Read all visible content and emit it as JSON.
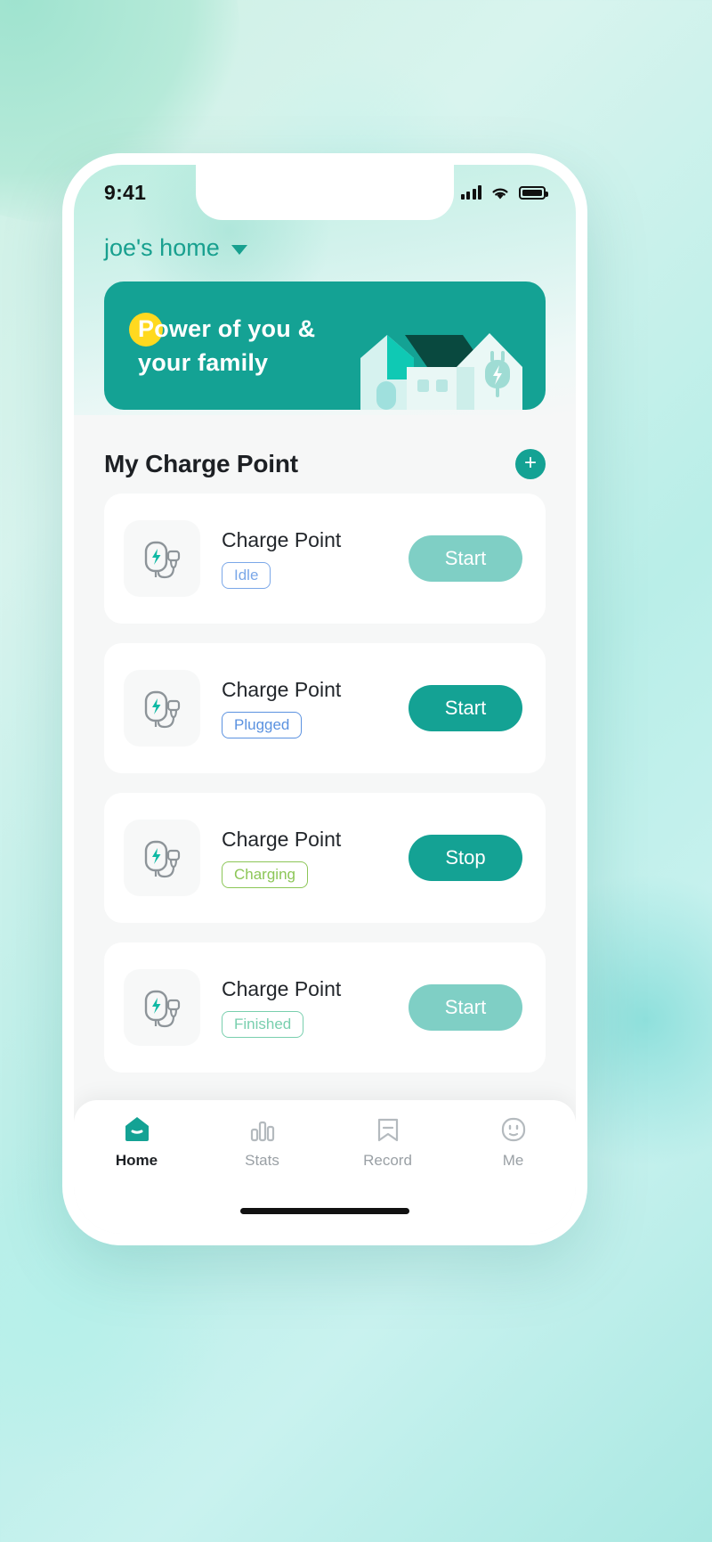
{
  "statusbar": {
    "time": "9:41",
    "signal_icon": "cellular-bars-icon",
    "wifi_icon": "wifi-icon",
    "battery_icon": "battery-icon"
  },
  "header": {
    "home_name": "joe's home",
    "caret_icon": "chevron-down-icon"
  },
  "banner": {
    "line1": "Power of you &",
    "line2": "your family",
    "sun_icon": "sun-circle-icon",
    "illustration": "house-with-charger-illustration",
    "bg_color": "#14a294",
    "sun_color": "#ffd91f"
  },
  "section": {
    "title": "My Charge Point",
    "add_label": "+",
    "add_icon": "plus-icon"
  },
  "charge_points": [
    {
      "name": "Charge Point",
      "status": "Idle",
      "status_color": "#7aa7e8",
      "action": "Start",
      "action_enabled": false,
      "action_color": "#7fcfc5",
      "icon": "ev-charger-icon"
    },
    {
      "name": "Charge Point",
      "status": "Plugged",
      "status_color": "#5b92e0",
      "action": "Start",
      "action_enabled": true,
      "action_color": "#14a294",
      "icon": "ev-charger-icon"
    },
    {
      "name": "Charge Point",
      "status": "Charging",
      "status_color": "#8cc657",
      "action": "Stop",
      "action_enabled": true,
      "action_color": "#14a294",
      "icon": "ev-charger-icon"
    },
    {
      "name": "Charge Point",
      "status": "Finished",
      "status_color": "#79cfae",
      "action": "Start",
      "action_enabled": false,
      "action_color": "#7fcfc5",
      "icon": "ev-charger-icon"
    }
  ],
  "tabs": [
    {
      "label": "Home",
      "icon": "home-icon",
      "active": true
    },
    {
      "label": "Stats",
      "icon": "bar-chart-icon",
      "active": false
    },
    {
      "label": "Record",
      "icon": "bookmark-icon",
      "active": false
    },
    {
      "label": "Me",
      "icon": "face-icon",
      "active": false
    }
  ],
  "theme": {
    "accent": "#14a294",
    "accent_muted": "#7fcfc5",
    "screen_bg": "#f6f7f7"
  }
}
